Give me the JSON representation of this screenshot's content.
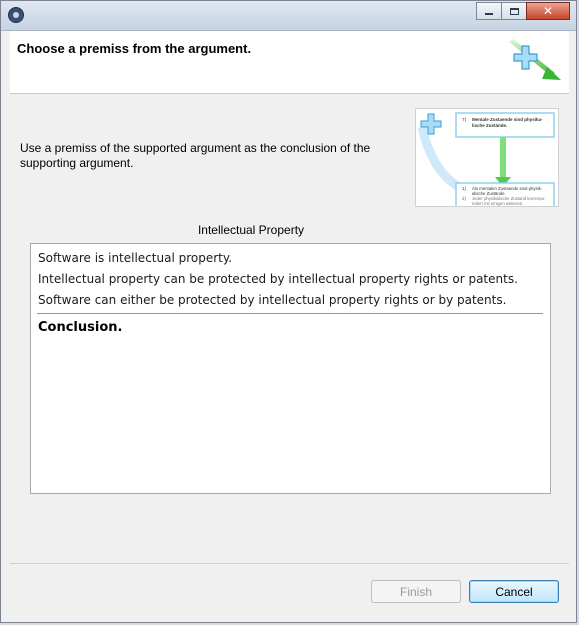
{
  "window": {
    "header_title": "Choose a premiss from the argument.",
    "description": "Use a premiss of the supported argument as the conclusion of the supporting argument."
  },
  "preview": {
    "top_item_number": "7)",
    "top_item_text_1": "Mentale Zustaende sind physika-",
    "top_item_text_2": "lische Zustände.",
    "bottom_item_1_number": "1)",
    "bottom_item_1_text_1": "Als mentalen Zustaende sind physik-",
    "bottom_item_1_text_2": "alische Zustände.",
    "bottom_item_2_number": "2)",
    "bottom_item_2_text_1": "Jeder physikalische Zustand korrespo-",
    "bottom_item_2_text_2": "ndiert mit einigen weiteren."
  },
  "argument": {
    "title": "Intellectual Property",
    "premises": [
      "Software is intellectual property.",
      "Intellectual property can be protected by intellectual property rights or patents.",
      "Software can either be protected by intellectual property rights or by patents."
    ],
    "conclusion": "Conclusion."
  },
  "buttons": {
    "finish": "Finish",
    "cancel": "Cancel"
  },
  "colors": {
    "accent_blue": "#62b6e6",
    "arrow_green": "#4dc64a"
  }
}
